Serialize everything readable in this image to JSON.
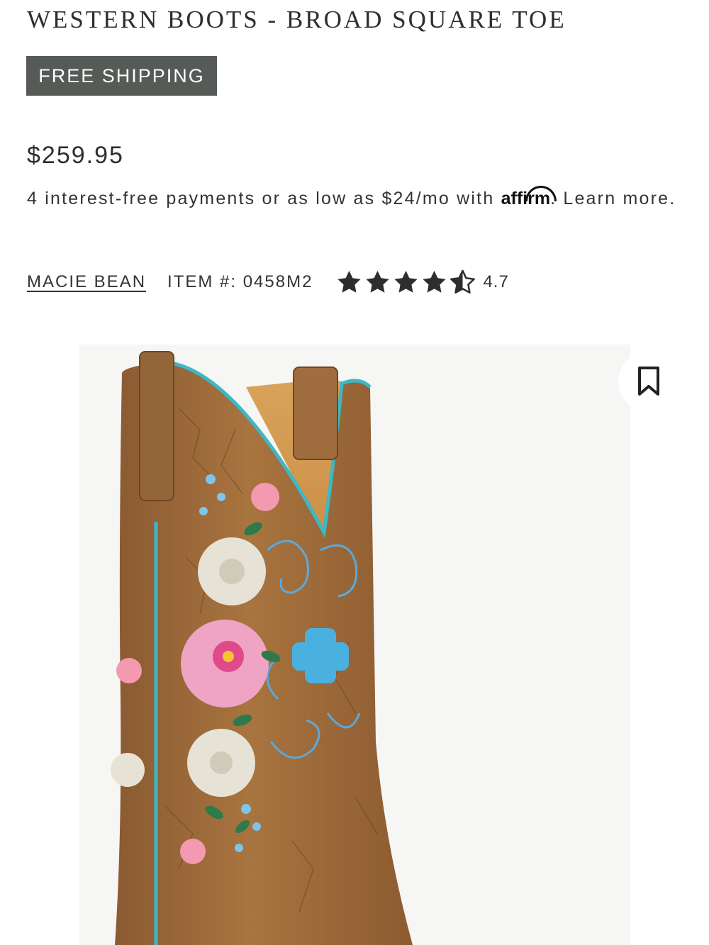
{
  "product": {
    "title": "WESTERN BOOTS - BROAD SQUARE TOE",
    "badge": "FREE SHIPPING",
    "price": "$259.95",
    "payments_text": "4 interest-free payments or as low as $24/mo with",
    "affirm_logo": "affirm",
    "learn_more": ". Learn more.",
    "brand": "MACIE BEAN",
    "item_number": "ITEM #: 0458M2",
    "rating": "4.7",
    "rating_value": 4.7,
    "rating_max": 5
  },
  "icons": {
    "star": "star-icon",
    "bookmark": "bookmark-icon"
  },
  "colors": {
    "badge_bg": "#565b57",
    "boot_leather": "#9a6a3e",
    "boot_trim": "#3cb8c6",
    "text": "#2e2e2e"
  }
}
